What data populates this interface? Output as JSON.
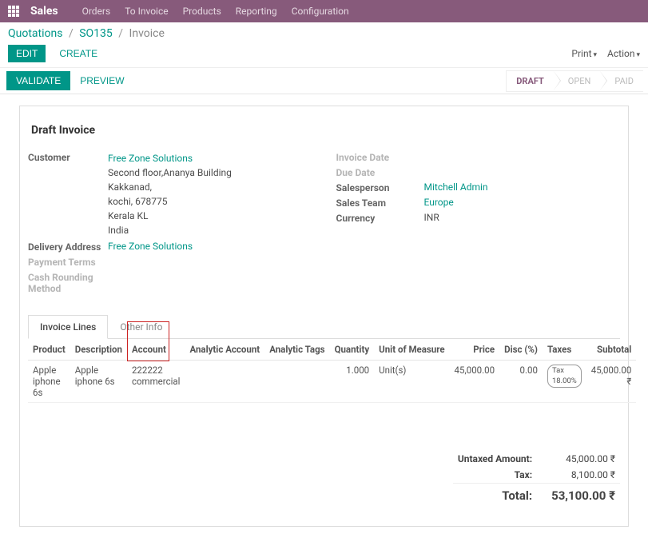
{
  "nav": {
    "brand": "Sales",
    "items": [
      "Orders",
      "To Invoice",
      "Products",
      "Reporting",
      "Configuration"
    ]
  },
  "breadcrumb": {
    "a": "Quotations",
    "b": "SO135",
    "c": "Invoice"
  },
  "buttons": {
    "edit": "EDIT",
    "create": "CREATE",
    "print": "Print",
    "action": "Action",
    "validate": "VALIDATE",
    "preview": "PREVIEW"
  },
  "status": {
    "draft": "DRAFT",
    "open": "OPEN",
    "paid": "PAID"
  },
  "title": "Draft Invoice",
  "labels": {
    "customer": "Customer",
    "delivery": "Delivery Address",
    "payment_terms": "Payment Terms",
    "cash_rounding": "Cash Rounding Method",
    "invoice_date": "Invoice Date",
    "due_date": "Due Date",
    "salesperson": "Salesperson",
    "sales_team": "Sales Team",
    "currency": "Currency"
  },
  "customer": {
    "name": "Free Zone Solutions",
    "addr1": "Second floor,Ananya Building",
    "addr2": "Kakkanad,",
    "addr3": "kochi, 678775",
    "addr4": "Kerala KL",
    "addr5": "India"
  },
  "delivery_name": "Free Zone Solutions",
  "salesperson": "Mitchell Admin",
  "sales_team": "Europe",
  "currency": "INR",
  "tabs": {
    "lines": "Invoice Lines",
    "other": "Other Info"
  },
  "columns": {
    "product": "Product",
    "description": "Description",
    "account": "Account",
    "analytic_account": "Analytic Account",
    "analytic_tags": "Analytic Tags",
    "quantity": "Quantity",
    "uom": "Unit of Measure",
    "price": "Price",
    "disc": "Disc (%)",
    "taxes": "Taxes",
    "subtotal": "Subtotal"
  },
  "row": {
    "product": "Apple iphone 6s",
    "description": "Apple iphone 6s",
    "account": "222222 commercial",
    "qty": "1.000",
    "uom": "Unit(s)",
    "price": "45,000.00",
    "disc": "0.00",
    "tax": "Tax 18.00%",
    "subtotal": "45,000.00 ₹"
  },
  "totals": {
    "untaxed_label": "Untaxed Amount:",
    "untaxed": "45,000.00 ₹",
    "tax_label": "Tax:",
    "tax": "8,100.00 ₹",
    "total_label": "Total:",
    "total": "53,100.00 ₹"
  }
}
